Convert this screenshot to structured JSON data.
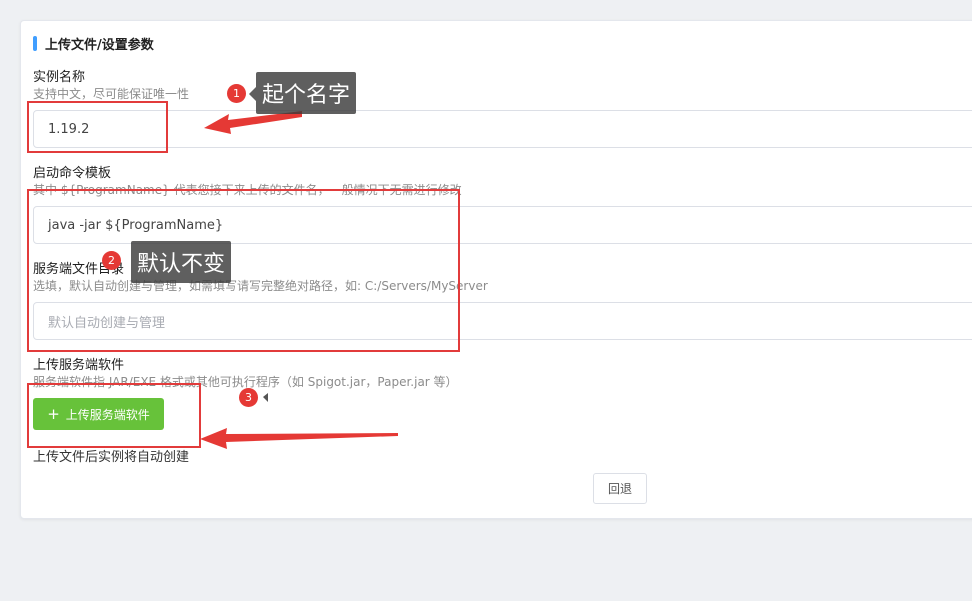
{
  "section": {
    "title": "上传文件/设置参数"
  },
  "fields": {
    "instance_name": {
      "label": "实例名称",
      "hint": "支持中文，尽可能保证唯一性",
      "value": "1.19.2"
    },
    "start_command": {
      "label": "启动命令模板",
      "hint": "其中 ${ProgramName} 代表您接下来上传的文件名，一般情况下无需进行修改",
      "value": "java -jar ${ProgramName}"
    },
    "server_dir": {
      "label": "服务端文件目录",
      "hint": "选填，默认自动创建与管理，如需填写请写完整绝对路径，如: C:/Servers/MyServer",
      "placeholder": "默认自动创建与管理"
    },
    "upload": {
      "label": "上传服务端软件",
      "hint": "服务端软件指 JAR/EXE 格式或其他可执行程序（如 Spigot.jar，Paper.jar 等）",
      "button_label": "上传服务端软件",
      "button_icon": "plus-icon",
      "note": "上传文件后实例将自动创建"
    }
  },
  "buttons": {
    "back": "回退"
  },
  "annotations": {
    "callout1": {
      "number": "1",
      "text": "起个名字"
    },
    "callout2": {
      "number": "2",
      "text": "默认不变"
    },
    "callout3": {
      "number": "3"
    }
  },
  "colors": {
    "accent": "#409eff",
    "upload_button": "#67c23a",
    "annotation_red": "#e23b3b"
  }
}
